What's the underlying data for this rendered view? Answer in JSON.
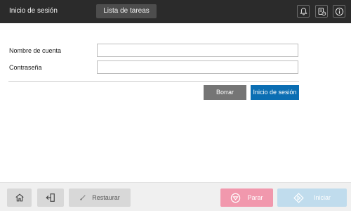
{
  "header": {
    "title": "Inicio de sesión",
    "tab_label": "Lista de tareas",
    "icons": [
      "bell-icon",
      "device-info-icon",
      "info-icon"
    ]
  },
  "form": {
    "account_label": "Nombre de cuenta",
    "account_value": "",
    "password_label": "Contraseña",
    "password_value": ""
  },
  "actions": {
    "clear_label": "Borrar",
    "login_label": "Inicio de sesión"
  },
  "bottom_bar": {
    "home_icon": "home-icon",
    "logout_icon": "logout-icon",
    "reset_label": "Restaurar",
    "stop_label": "Parar",
    "start_label": "Iniciar"
  },
  "colors": {
    "top_bar": "#2b2b2b",
    "login_button": "#0b6eb3",
    "clear_button": "#757575",
    "stop_button": "#f198ad",
    "start_button": "#c0dced"
  }
}
